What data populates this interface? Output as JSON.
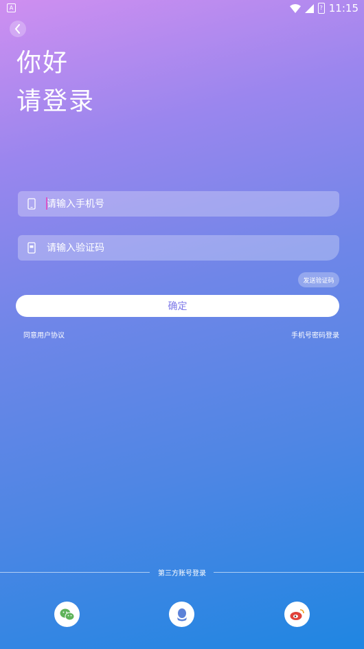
{
  "status_bar": {
    "notification_icon": "a-box-icon",
    "time": "11:15",
    "icons": [
      "wifi-icon",
      "signal-icon",
      "battery-icon"
    ]
  },
  "header": {
    "back_icon": "chevron-left-icon",
    "greeting": "你好",
    "subtitle": "请登录"
  },
  "form": {
    "phone_placeholder": "请输入手机号",
    "phone_icon": "phone-icon",
    "code_placeholder": "请输入验证码",
    "code_icon": "sms-phone-icon",
    "send_code_label": "发送验证码",
    "confirm_label": "确定",
    "agreement_label": "同意用户协议",
    "password_login_label": "手机号密码登录"
  },
  "third_party": {
    "label": "第三方账号登录",
    "providers": [
      {
        "name": "wechat",
        "icon": "wechat-icon",
        "color": "#5fb35a"
      },
      {
        "name": "qq",
        "icon": "qq-icon",
        "color": "#5c82d8"
      },
      {
        "name": "weibo",
        "icon": "weibo-icon",
        "color": "#e0433b"
      }
    ]
  },
  "colors": {
    "gradient_top": "#cf8ff0",
    "gradient_bottom": "#1f86e2",
    "confirm_text": "#7d78e8",
    "caret": "#d957c8"
  }
}
